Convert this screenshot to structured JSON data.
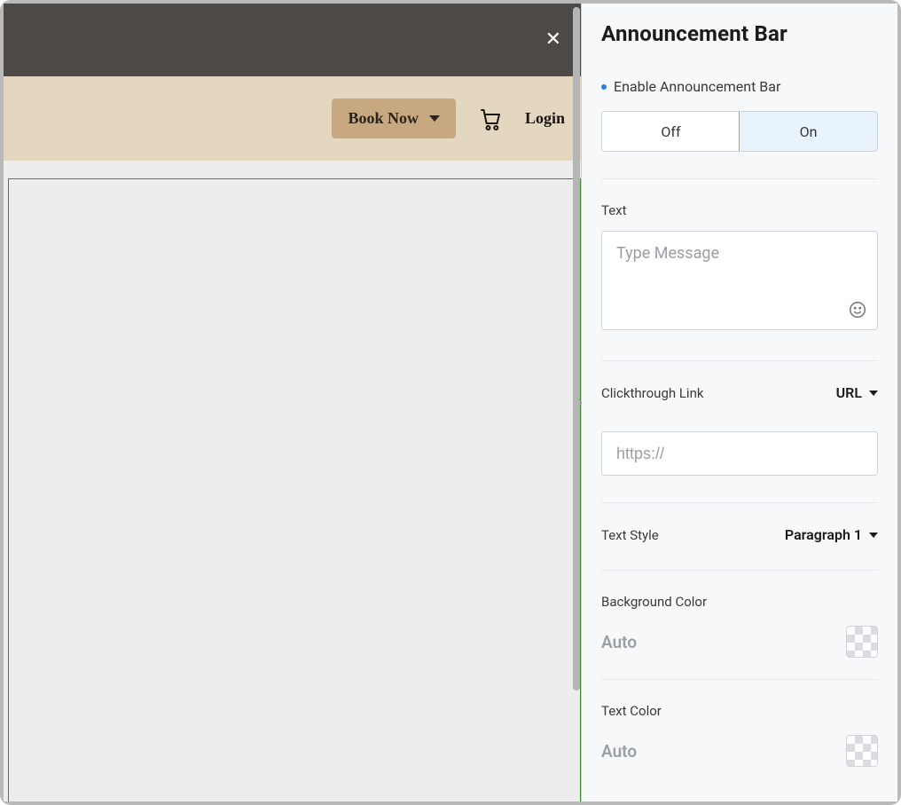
{
  "panel_title": "Announcement Bar",
  "preview": {
    "book_label": "Book Now",
    "login_label": "Login"
  },
  "enable": {
    "label": "Enable Announcement Bar",
    "off_label": "Off",
    "on_label": "On",
    "value": "On"
  },
  "text_field": {
    "label": "Text",
    "placeholder": "Type Message",
    "value": ""
  },
  "link": {
    "label": "Clickthrough Link",
    "type_label": "URL",
    "placeholder": "https://",
    "value": ""
  },
  "text_style": {
    "label": "Text Style",
    "value": "Paragraph 1"
  },
  "bg_color": {
    "label": "Background Color",
    "value": "Auto"
  },
  "text_color": {
    "label": "Text Color",
    "value": "Auto"
  }
}
